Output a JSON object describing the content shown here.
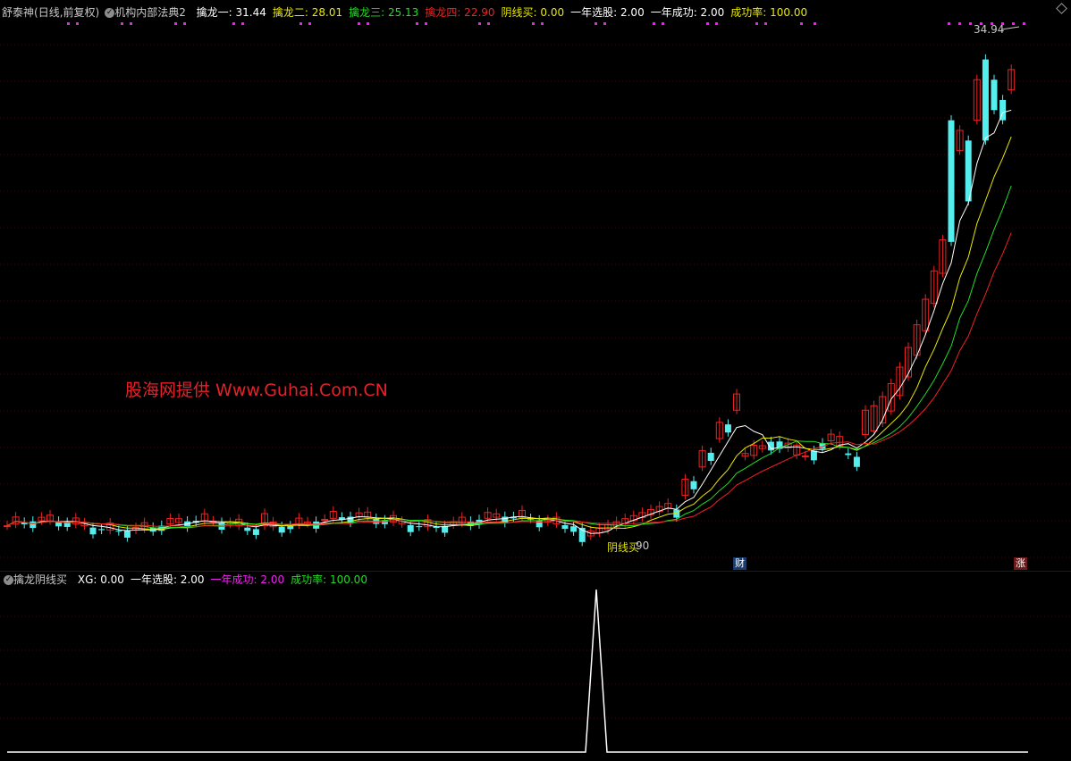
{
  "top_header": {
    "stock_name": "舒泰神",
    "mode": "(日线,前复权)",
    "formula": "机构内部法典2",
    "items": [
      {
        "label": "擒龙一: 31.44",
        "color": "#ffffff"
      },
      {
        "label": "擒龙二: 28.01",
        "color": "#e8e800"
      },
      {
        "label": "擒龙三: 25.13",
        "color": "#22dd22"
      },
      {
        "label": "擒龙四: 22.90",
        "color": "#ee2222"
      },
      {
        "label": "阴线买: 0.00",
        "color": "#e8e800"
      },
      {
        "label": "一年选股: 2.00",
        "color": "#ffffff"
      },
      {
        "label": "一年成功: 2.00",
        "color": "#ffffff"
      },
      {
        "label": "成功率: 100.00",
        "color": "#e8e800"
      }
    ]
  },
  "bottom_header": {
    "formula": "擒龙阴线买",
    "items": [
      {
        "label": "XG: 0.00",
        "color": "#ffffff"
      },
      {
        "label": "一年选股: 2.00",
        "color": "#ffffff"
      },
      {
        "label": "一年成功: 2.00",
        "color": "#ee22ee"
      },
      {
        "label": "成功率: 100.00",
        "color": "#22dd22"
      }
    ]
  },
  "watermark": "股海网提供 Www.Guhai.Com.CN",
  "max_price_label": "34.94",
  "signal": {
    "label": "阴线买",
    "value": "90"
  },
  "badges": {
    "finance": "财",
    "limit_up": "涨"
  },
  "colors": {
    "up": "#ee2222",
    "down": "#55eeee",
    "ma1": "#ffffff",
    "ma2": "#e8e800",
    "ma3": "#22dd22",
    "ma4": "#ee2222",
    "dots": "#ee22ee"
  }
}
